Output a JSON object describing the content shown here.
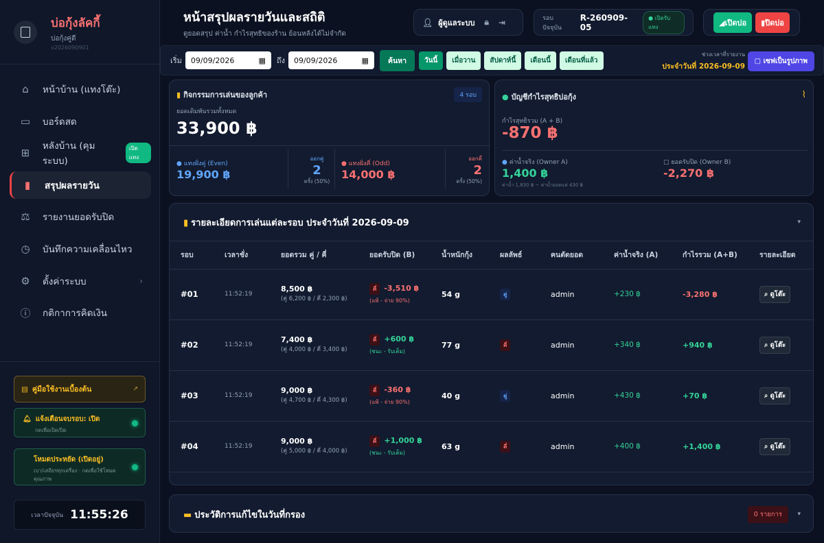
{
  "sidebar": {
    "brand_title": "บ่อกุ้งลัคกี้",
    "brand_sub": "บ่อกุ้งคู่ดี",
    "version": "v2026090901",
    "items": [
      {
        "label": "หน้าบ้าน (แทงโต๊ะ)",
        "icon": "home-icon"
      },
      {
        "label": "บอร์ดสด",
        "icon": "monitor-icon"
      },
      {
        "label": "หลังบ้าน (คุมระบบ)",
        "icon": "layout-icon",
        "badge": "เปิดแทง"
      },
      {
        "label": "สรุปผลรายวัน",
        "icon": "bar-chart-icon"
      },
      {
        "label": "รายงานยอดรับปิด",
        "icon": "scale-icon"
      },
      {
        "label": "บันทึกความเคลื่อนไหว",
        "icon": "clock-icon"
      },
      {
        "label": "ตั้งค่าระบบ",
        "icon": "gear-icon"
      },
      {
        "label": "กติกาการคิดเงิน",
        "icon": "info-icon"
      }
    ],
    "guide": "คู่มือใช้งานเบื้องต้น",
    "notify_title": "แจ้งเตือนจบรอบ: เปิด",
    "notify_sub": "กดเพื่อเปิด/ปิด",
    "saver_title": "โหมดประหยัด (เปิดอยู่)",
    "saver_sub": "เบา/เสถียรทุกเครื่อง · กดเพื่อใช้โหมดคุณภาพ",
    "clock_label": "เวลาปัจจุบัน",
    "clock_value": "11:55:26"
  },
  "header": {
    "title": "หน้าสรุปผลรายวันและสถิติ",
    "subtitle": "ดูยอดสรุป ค่าน้ำ กำไรสุทธิของร้าน ย้อนหลังได้ไม่จำกัด",
    "user": "ผู้ดูแลระบบ",
    "round_label": "รอบปัจจุบัน",
    "round_value": "R-260909-05",
    "round_status": "เปิดรับแทง",
    "open_btn": "เปิดบ่อ",
    "close_btn": "ปิดบ่อ"
  },
  "filter": {
    "start_label": "เริ่ม",
    "start_date": "09/09/2026",
    "end_label": "ถึง",
    "end_date": "09/09/2026",
    "search_btn": "ค้นหา",
    "chips": [
      "วันนี้",
      "เมื่อวาน",
      "สัปดาห์นี้",
      "เดือนนี้",
      "เดือนที่แล้ว"
    ],
    "range_label": "ช่วงเวลาที่รายงาน",
    "range_value": "ประจำวันที่ 2026-09-09",
    "save_btn": "▢ เซฟเป็นรูปภาพ"
  },
  "activity": {
    "title": "กิจกรรมการเล่นของลูกค้า",
    "rounds": "4 รอบ",
    "total_label": "ยอดเดิมพันรวมทั้งหมด",
    "total": "33,900 ฿",
    "even_label": "แทงฝั่งคู่ (Even)",
    "even_value": "19,900 ฿",
    "even_out_label": "ออกคู่",
    "even_out": "2",
    "even_out_pct": "ครั้ง (50%)",
    "odd_label": "แทงฝั่งคี่ (Odd)",
    "odd_value": "14,000 ฿",
    "odd_out_label": "ออกคี่",
    "odd_out": "2",
    "odd_out_pct": "ครั้ง (50%)"
  },
  "profit": {
    "title": "บัญชีกำไรสุทธิบ่อกุ้ง",
    "net_label": "กำไรสุทธิรวม (A + B)",
    "net": "-870 ฿",
    "water_label": "ค่าน้ำจริง (Owner A)",
    "water": "1,400 ฿",
    "water_note": "ค่าน้ำ 1,830 ฿ − ค่าน้ำยอดแต่ 430 ฿",
    "close_label": "ยอดรับปิด (Owner B)",
    "close": "-2,270 ฿"
  },
  "detail": {
    "title": "รายละเอียดการเล่นแต่ละรอบ ประจำวันที่ 2026-09-09",
    "headers": [
      "รอบ",
      "เวลาชั่ง",
      "ยอดรวม คู่ / คี่",
      "ยอดรับปิด (B)",
      "น้ำหนักกุ้ง",
      "ผลลัพธ์",
      "คนตัดยอด",
      "ค่าน้ำจริง (A)",
      "กำไรรวม (A+B)",
      "รายละเอียด"
    ],
    "rows": [
      {
        "id": "#01",
        "time": "11:52:19",
        "total": "8,500 ฿",
        "split": "(คู่ 6,200 ฿ / คี่ 2,300 ฿)",
        "side": "คี่",
        "payout": "-3,510 ฿",
        "payout_note": "(แพ้ - จ่าย 90%)",
        "weight": "54 g",
        "result": "คู่",
        "cutter": "admin",
        "water": "+230 ฿",
        "profit": "-3,280 ฿"
      },
      {
        "id": "#02",
        "time": "11:52:19",
        "total": "7,400 ฿",
        "split": "(คู่ 4,000 ฿ / คี่ 3,400 ฿)",
        "side": "คี่",
        "payout": "+600 ฿",
        "payout_note": "(ชนะ - รับเต็ม)",
        "weight": "77 g",
        "result": "คี่",
        "cutter": "admin",
        "water": "+340 ฿",
        "profit": "+940 ฿"
      },
      {
        "id": "#03",
        "time": "11:52:19",
        "total": "9,000 ฿",
        "split": "(คู่ 4,700 ฿ / คี่ 4,300 ฿)",
        "side": "คี่",
        "payout": "-360 ฿",
        "payout_note": "(แพ้ - จ่าย 90%)",
        "weight": "40 g",
        "result": "คู่",
        "cutter": "admin",
        "water": "+430 ฿",
        "profit": "+70 ฿"
      },
      {
        "id": "#04",
        "time": "11:52:19",
        "total": "9,000 ฿",
        "split": "(คู่ 5,000 ฿ / คี่ 4,000 ฿)",
        "side": "คี่",
        "payout": "+1,000 ฿",
        "payout_note": "(ชนะ - รับเต็ม)",
        "weight": "63 g",
        "result": "คี่",
        "cutter": "admin",
        "water": "+400 ฿",
        "profit": "+1,400 ฿"
      }
    ],
    "view_btn": "ดูโต๊ะ"
  },
  "history": {
    "title": "ประวัติการแก้ไขในวันที่กรอง",
    "count": "0 รายการ"
  },
  "colors": {
    "accent": "#ef4444",
    "green": "#34d399",
    "red": "#f87171",
    "blue": "#60a5fa",
    "gold": "#fbbf24"
  }
}
